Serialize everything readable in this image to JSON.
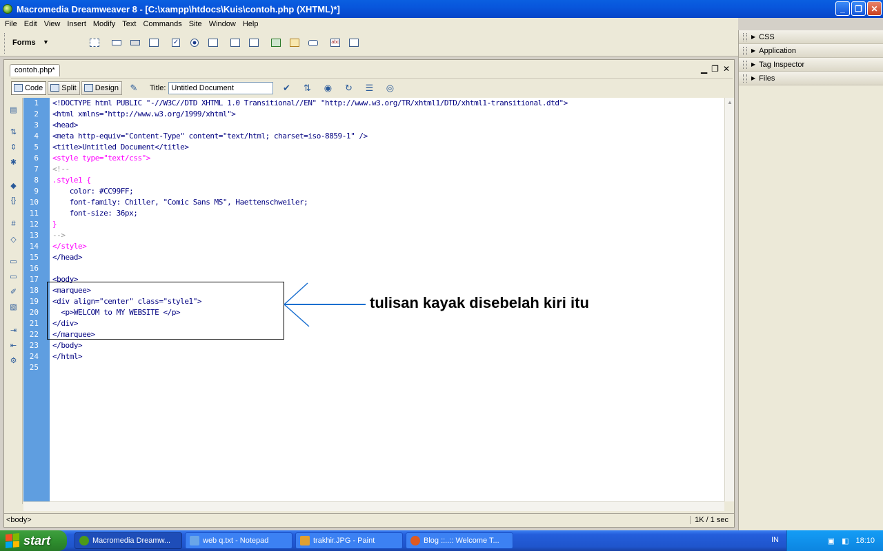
{
  "window": {
    "title": "Macromedia Dreamweaver 8 - [C:\\xampp\\htdocs\\Kuis\\contoh.php (XHTML)*]",
    "buttons": [
      "_",
      "❐",
      "✕"
    ]
  },
  "menu": [
    "File",
    "Edit",
    "View",
    "Insert",
    "Modify",
    "Text",
    "Commands",
    "Site",
    "Window",
    "Help"
  ],
  "insert_bar": {
    "category": "Forms"
  },
  "panels": [
    "CSS",
    "Application",
    "Tag Inspector",
    "Files"
  ],
  "document": {
    "tab": "contoh.php*",
    "views": {
      "code": "Code",
      "split": "Split",
      "design": "Design"
    },
    "title_label": "Title:",
    "title_value": "Untitled Document"
  },
  "line_numbers": [
    "1",
    "2",
    "3",
    "4",
    "5",
    "6",
    "7",
    "8",
    "9",
    "10",
    "11",
    "12",
    "13",
    "14",
    "15",
    "16",
    "17",
    "18",
    "19",
    "20",
    "21",
    "22",
    "23",
    "24",
    "25"
  ],
  "code_lines": [
    "<!DOCTYPE html PUBLIC \"-//W3C//DTD XHTML 1.0 Transitional//EN\" \"http://www.w3.org/TR/xhtml1/DTD/xhtml1-transitional.dtd\">",
    "<html xmlns=\"http://www.w3.org/1999/xhtml\">",
    "<head>",
    "<meta http-equiv=\"Content-Type\" content=\"text/html; charset=iso-8859-1\" />",
    "<title>Untitled Document</title>",
    "<style type=\"text/css\">",
    "<!--",
    ".style1 {",
    "    color: #CC99FF;",
    "    font-family: Chiller, \"Comic Sans MS\", Haettenschweiler;",
    "    font-size: 36px;",
    "}",
    "-->",
    "</style>",
    "</head>",
    "",
    "<body>",
    "<marquee>",
    "<div align=\"center\" class=\"style1\">",
    "  <p>WELCOM to MY WEBSITE </p>",
    "</div>",
    "</marquee>",
    "</body>",
    "</html>",
    ""
  ],
  "line_styles": [
    "tag",
    "tag",
    "tag",
    "tag",
    "tag",
    "css",
    "comment",
    "css",
    "css-prop",
    "css-prop",
    "css-prop",
    "css",
    "comment",
    "css",
    "tag",
    "plain",
    "tag",
    "tag",
    "tag",
    "tag",
    "tag",
    "tag",
    "tag",
    "tag",
    "plain"
  ],
  "annotation": "tulisan kayak disebelah kiri itu",
  "status": {
    "tag_selector": "<body>",
    "size": "1K / 1 sec"
  },
  "taskbar": {
    "start": "start",
    "items": [
      {
        "label": "Macromedia Dreamw...",
        "color": "#4c9a1a"
      },
      {
        "label": "web q.txt - Notepad",
        "color": "#6aa6e8"
      },
      {
        "label": "trakhir.JPG - Paint",
        "color": "#e0a030"
      },
      {
        "label": "Blog ::..:: Welcome T...",
        "color": "#e05a20"
      }
    ],
    "language": "IN",
    "clock": "18:10"
  }
}
